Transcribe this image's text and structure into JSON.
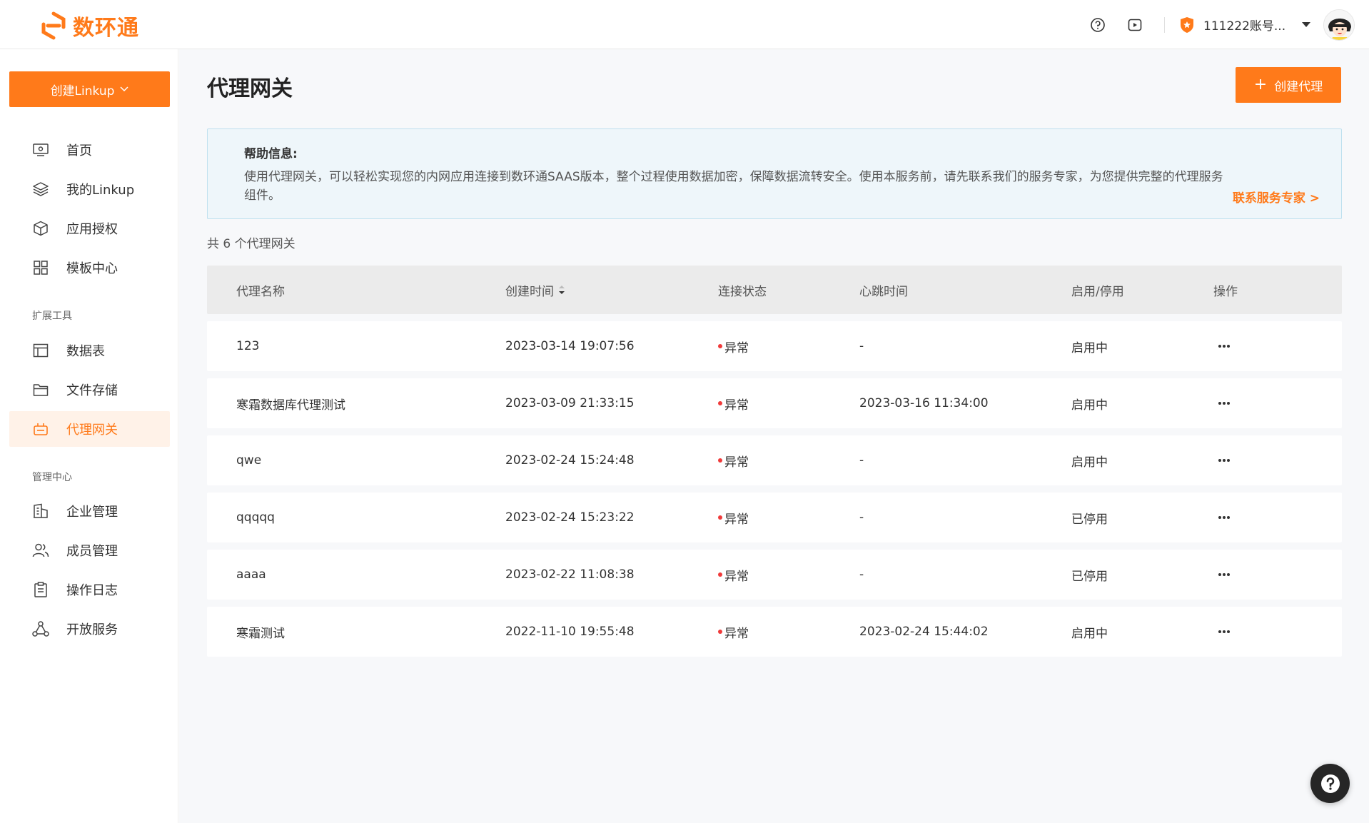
{
  "app": {
    "brand_name": "数环通",
    "brand_color": "#ff7a1a"
  },
  "topbar": {
    "icons": [
      "help-circle-icon",
      "video-play-icon"
    ],
    "account_badge_icon": "orange-shield-star-icon",
    "account_name": "111222账号...",
    "avatar_icon": "user-avatar"
  },
  "sidebar": {
    "create_button_label": "创建Linkup",
    "main_items": [
      {
        "label": "首页",
        "icon": "home-monitor-icon"
      },
      {
        "label": "我的Linkup",
        "icon": "layers-icon"
      },
      {
        "label": "应用授权",
        "icon": "cube-icon"
      },
      {
        "label": "模板中心",
        "icon": "grid-icon"
      }
    ],
    "section_tools": "扩展工具",
    "tool_items": [
      {
        "label": "数据表",
        "icon": "table-icon"
      },
      {
        "label": "文件存储",
        "icon": "folder-icon"
      },
      {
        "label": "代理网关",
        "icon": "gateway-icon",
        "active": true
      }
    ],
    "section_admin": "管理中心",
    "admin_items": [
      {
        "label": "企业管理",
        "icon": "building-icon"
      },
      {
        "label": "成员管理",
        "icon": "users-icon"
      },
      {
        "label": "操作日志",
        "icon": "clipboard-icon"
      },
      {
        "label": "开放服务",
        "icon": "share-nodes-icon"
      }
    ]
  },
  "main": {
    "title": "代理网关",
    "create_proxy_label": "创建代理",
    "help": {
      "title": "帮助信息:",
      "text": "使用代理网关，可以轻松实现您的内网应用连接到数环通SAAS版本，整个过程使用数据加密，保障数据流转安全。使用本服务前，请先联系我们的服务专家，为您提供完整的代理服务组件。",
      "link": "联系服务专家 >"
    },
    "count_text": "共 6 个代理网关",
    "table": {
      "headers": [
        "代理名称",
        "创建时间",
        "连接状态",
        "心跳时间",
        "启用/停用",
        "操作"
      ],
      "rows": [
        {
          "name": "123",
          "created": "2023-03-14 19:07:56",
          "status": "异常",
          "heartbeat": "-",
          "enabled": "启用中"
        },
        {
          "name": "寒霜数据库代理测试",
          "created": "2023-03-09 21:33:15",
          "status": "异常",
          "heartbeat": "2023-03-16 11:34:00",
          "enabled": "启用中"
        },
        {
          "name": "qwe",
          "created": "2023-02-24 15:24:48",
          "status": "异常",
          "heartbeat": "-",
          "enabled": "启用中"
        },
        {
          "name": "qqqqq",
          "created": "2023-02-24 15:23:22",
          "status": "异常",
          "heartbeat": "-",
          "enabled": "已停用"
        },
        {
          "name": "aaaa",
          "created": "2023-02-22 11:08:38",
          "status": "异常",
          "heartbeat": "-",
          "enabled": "已停用"
        },
        {
          "name": "寒霜测试",
          "created": "2022-11-10 19:55:48",
          "status": "异常",
          "heartbeat": "2023-02-24 15:44:02",
          "enabled": "启用中"
        }
      ]
    }
  }
}
